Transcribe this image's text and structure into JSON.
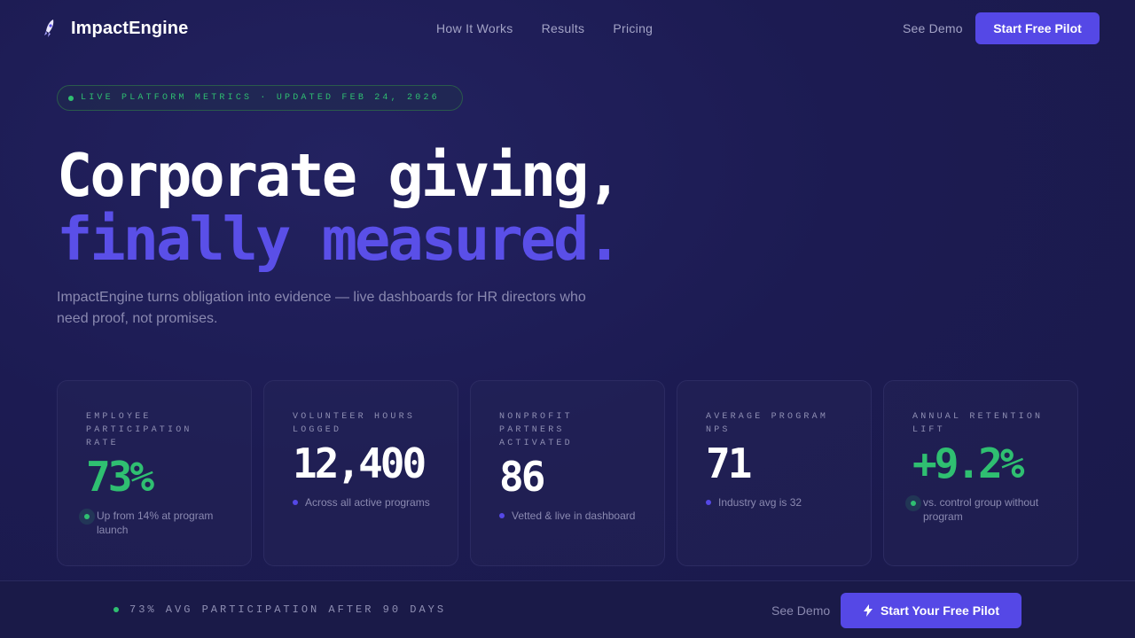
{
  "nav": {
    "brand": "ImpactEngine",
    "brand_icon": "rocket-icon",
    "links": [
      "How It Works",
      "Results",
      "Pricing"
    ],
    "see_demo": "See Demo",
    "cta": "Start Free Pilot"
  },
  "badge": {
    "text": "LIVE PLATFORM METRICS · UPDATED FEB 24, 2026"
  },
  "hero": {
    "line1": "Corporate giving,",
    "line2": "finally measured.",
    "subtitle": "ImpactEngine turns obligation into evidence — live dashboards for HR directors who need proof, not promises."
  },
  "metrics": [
    {
      "label": "EMPLOYEE PARTICIPATION RATE",
      "value": "73%",
      "note": "Up from 14% at program launch",
      "accent": "green"
    },
    {
      "label": "VOLUNTEER HOURS LOGGED",
      "value": "12,400",
      "note": "Across all active programs",
      "accent": "purple"
    },
    {
      "label": "NONPROFIT PARTNERS ACTIVATED",
      "value": "86",
      "note": "Vetted & live in dashboard",
      "accent": "purple"
    },
    {
      "label": "AVERAGE PROGRAM NPS",
      "value": "71",
      "note": "Industry avg is 32",
      "accent": "purple"
    },
    {
      "label": "ANNUAL RETENTION LIFT",
      "value": "+9.2%",
      "note": "vs. control group without program",
      "accent": "green"
    }
  ],
  "bottom_bar": {
    "text": "73% AVG PARTICIPATION AFTER 90 DAYS",
    "see_demo": "See Demo",
    "cta": "Start Your Free Pilot",
    "cta_icon": "bolt-icon"
  },
  "colors": {
    "accent": "#5548e6",
    "green": "#2fbf71",
    "background": "#1c1b52"
  }
}
